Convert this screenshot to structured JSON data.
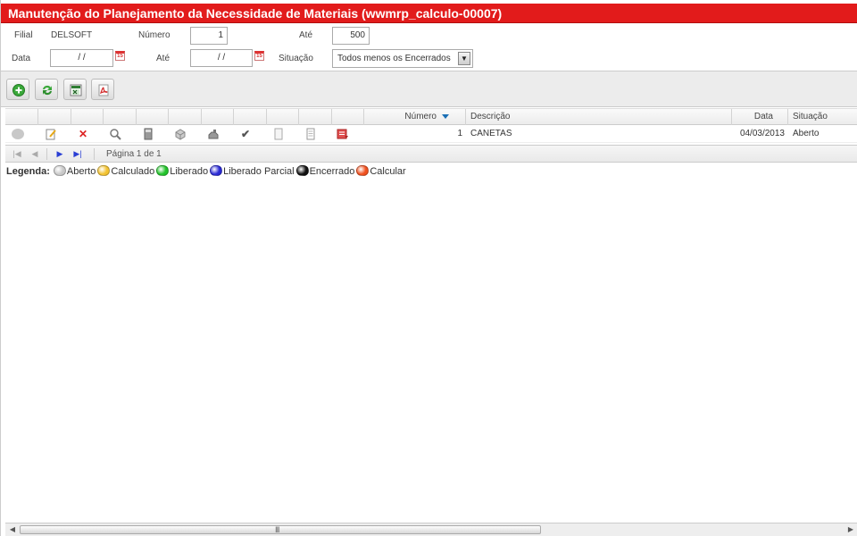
{
  "title": "Manutenção do Planejamento da Necessidade de Materiais (wwmrp_calculo-00007)",
  "filters": {
    "filial_label": "Filial",
    "filial_value": "DELSOFT",
    "numero_label": "Número",
    "numero_value": "1",
    "ate_label": "Até",
    "ate_value": "500",
    "data_label": "Data",
    "data_value": "/ /",
    "data_ate_label": "Até",
    "data_ate_value": "/ /",
    "situacao_label": "Situação",
    "situacao_value": "Todos menos os Encerrados",
    "calendar_glyph": "15"
  },
  "toolbar": {
    "buttons": [
      {
        "name": "add-button",
        "icon": "plus-icon"
      },
      {
        "name": "refresh-button",
        "icon": "refresh-icon"
      },
      {
        "name": "export-excel-button",
        "icon": "excel-icon"
      },
      {
        "name": "export-pdf-button",
        "icon": "pdf-icon"
      }
    ]
  },
  "grid": {
    "columns": {
      "numero": "Número",
      "descricao": "Descrição",
      "data": "Data",
      "situacao": "Situação"
    },
    "rows": [
      {
        "numero": "1",
        "descricao": "CANETAS",
        "data": "04/03/2013",
        "situacao": "Aberto",
        "status_color": "#c8c8c8"
      }
    ]
  },
  "pager": {
    "text": "Página 1 de 1"
  },
  "legend": {
    "title": "Legenda:",
    "items": [
      {
        "label": "Aberto",
        "color": "#c8c8c8"
      },
      {
        "label": "Calculado",
        "color": "#f2c230"
      },
      {
        "label": "Liberado",
        "color": "#22c32a"
      },
      {
        "label": "Liberado Parcial",
        "color": "#2a2ad4"
      },
      {
        "label": "Encerrado",
        "color": "#111111"
      },
      {
        "label": "Calcular",
        "color": "#f0501e"
      }
    ]
  },
  "scrollbar": {
    "grip": "III"
  }
}
